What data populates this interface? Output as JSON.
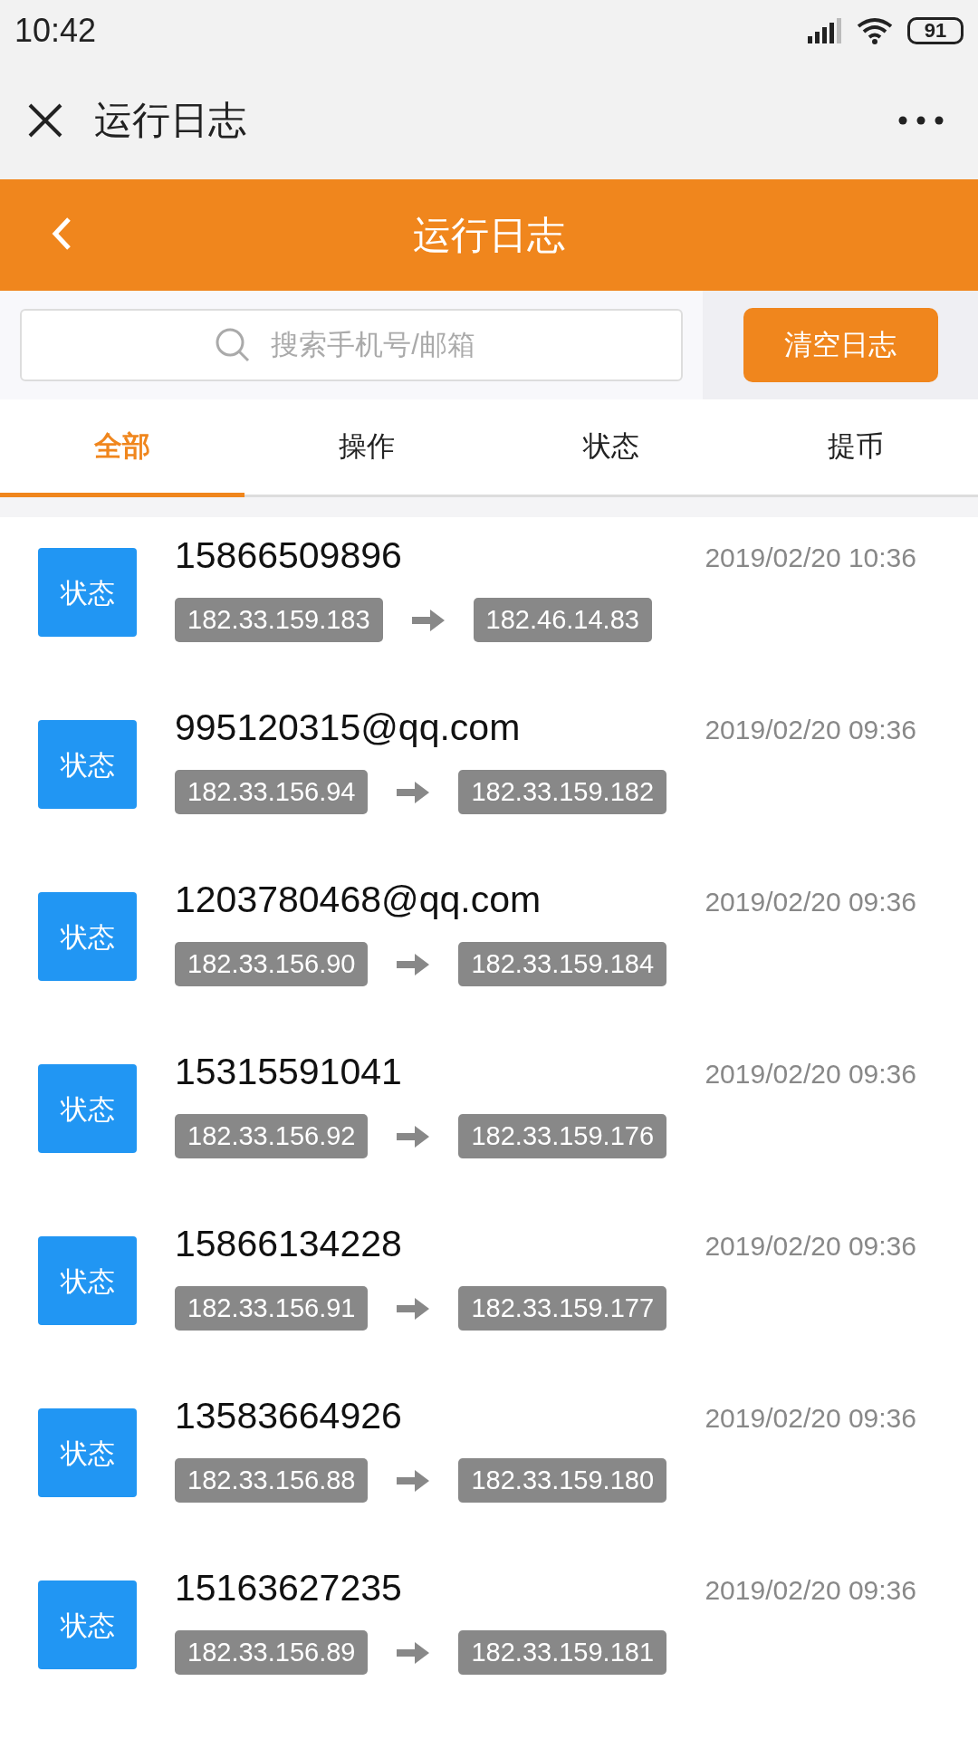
{
  "status_bar": {
    "time": "10:42",
    "battery": "91"
  },
  "app_bar": {
    "title": "运行日志"
  },
  "header": {
    "title": "运行日志"
  },
  "search": {
    "placeholder": "搜索手机号/邮箱"
  },
  "clear_button": "清空日志",
  "tabs": [
    {
      "label": "全部",
      "selected": true
    },
    {
      "label": "操作",
      "selected": false
    },
    {
      "label": "状态",
      "selected": false
    },
    {
      "label": "提币",
      "selected": false
    }
  ],
  "logs": [
    {
      "badge": "状态",
      "account": "15866509896",
      "time": "2019/02/20 10:36",
      "from_ip": "182.33.159.183",
      "to_ip": "182.46.14.83"
    },
    {
      "badge": "状态",
      "account": "995120315@qq.com",
      "time": "2019/02/20 09:36",
      "from_ip": "182.33.156.94",
      "to_ip": "182.33.159.182"
    },
    {
      "badge": "状态",
      "account": "1203780468@qq.com",
      "time": "2019/02/20 09:36",
      "from_ip": "182.33.156.90",
      "to_ip": "182.33.159.184"
    },
    {
      "badge": "状态",
      "account": "15315591041",
      "time": "2019/02/20 09:36",
      "from_ip": "182.33.156.92",
      "to_ip": "182.33.159.176"
    },
    {
      "badge": "状态",
      "account": "15866134228",
      "time": "2019/02/20 09:36",
      "from_ip": "182.33.156.91",
      "to_ip": "182.33.159.177"
    },
    {
      "badge": "状态",
      "account": "13583664926",
      "time": "2019/02/20 09:36",
      "from_ip": "182.33.156.88",
      "to_ip": "182.33.159.180"
    },
    {
      "badge": "状态",
      "account": "15163627235",
      "time": "2019/02/20 09:36",
      "from_ip": "182.33.156.89",
      "to_ip": "182.33.159.181"
    }
  ]
}
